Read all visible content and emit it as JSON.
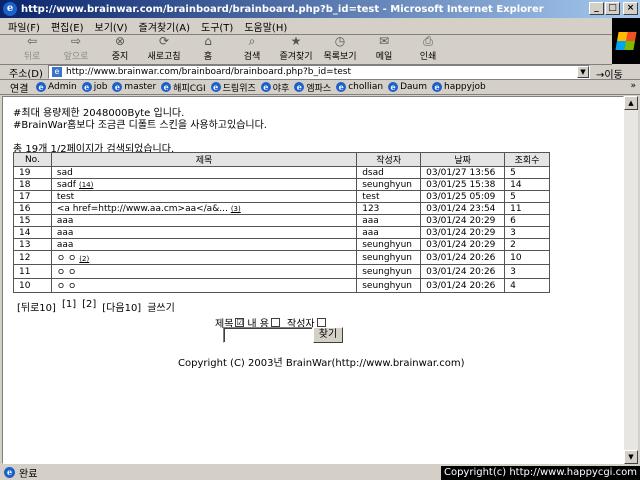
{
  "window": {
    "title": "http://www.brainwar.com/brainboard/brainboard.php?b_id=test - Microsoft Internet Explorer"
  },
  "menu": [
    "파일(F)",
    "편집(E)",
    "보기(V)",
    "즐겨찾기(A)",
    "도구(T)",
    "도움말(H)"
  ],
  "toolbar": [
    {
      "label": "뒤로",
      "icon": "back-arrow-icon",
      "enabled": false
    },
    {
      "label": "앞으로",
      "icon": "forward-arrow-icon",
      "enabled": false
    },
    {
      "label": "중지",
      "icon": "stop-icon",
      "enabled": true
    },
    {
      "label": "새로고침",
      "icon": "refresh-icon",
      "enabled": true
    },
    {
      "label": "홈",
      "icon": "home-icon",
      "enabled": true
    },
    {
      "label": "검색",
      "icon": "search-icon",
      "enabled": true
    },
    {
      "label": "즐겨찾기",
      "icon": "favorites-icon",
      "enabled": true
    },
    {
      "label": "목록보기",
      "icon": "history-icon",
      "enabled": true
    },
    {
      "label": "메일",
      "icon": "mail-icon",
      "enabled": true
    },
    {
      "label": "인쇄",
      "icon": "print-icon",
      "enabled": true
    }
  ],
  "address": {
    "label": "주소(D)",
    "url": "http://www.brainwar.com/brainboard/brainboard.php?b_id=test",
    "go": "이동"
  },
  "links": {
    "label": "연결",
    "items": [
      "Admin",
      "job",
      "master",
      "해피CGI",
      "드림위즈",
      "야후",
      "엠파스",
      "chollian",
      "Daum",
      "happyjob"
    ],
    "more": "»"
  },
  "page": {
    "notice1": "#최대 용량제한 2048000Byte 입니다.",
    "notice2": "#BrainWar홈보다 조금큰 디폴트 스킨을 사용하고있습니다.",
    "count": "총 19개  1/2페이지가 검색되었습니다.",
    "headers": [
      "No.",
      "제목",
      "작성자",
      "날짜",
      "조회수"
    ],
    "rows": [
      {
        "no": "19",
        "title": "sad",
        "comments": "",
        "author": "dsad",
        "date": "03/01/27 13:56",
        "views": "5"
      },
      {
        "no": "18",
        "title": "sadf",
        "comments": "(14)",
        "author": "seunghyun",
        "date": "03/01/25 15:38",
        "views": "14"
      },
      {
        "no": "17",
        "title": "test",
        "comments": "",
        "author": "test",
        "date": "03/01/25 05:09",
        "views": "5"
      },
      {
        "no": "16",
        "title": "<a href=http://www.aa.cm>aa</a&...",
        "comments": "(3)",
        "author": "123",
        "date": "03/01/24 23:54",
        "views": "11"
      },
      {
        "no": "15",
        "title": "aaa",
        "comments": "",
        "author": "aaa",
        "date": "03/01/24 20:29",
        "views": "6"
      },
      {
        "no": "14",
        "title": "aaa",
        "comments": "",
        "author": "aaa",
        "date": "03/01/24 20:29",
        "views": "3"
      },
      {
        "no": "13",
        "title": "aaa",
        "comments": "",
        "author": "seunghyun",
        "date": "03/01/24 20:29",
        "views": "2"
      },
      {
        "no": "12",
        "title": "ㅇ ㅇ",
        "comments": "(2)",
        "author": "seunghyun",
        "date": "03/01/24 20:26",
        "views": "10"
      },
      {
        "no": "11",
        "title": "ㅇ ㅇ",
        "comments": "",
        "author": "seunghyun",
        "date": "03/01/24 20:26",
        "views": "3"
      },
      {
        "no": "10",
        "title": "ㅇ ㅇ",
        "comments": "",
        "author": "seunghyun",
        "date": "03/01/24 20:26",
        "views": "4"
      }
    ],
    "pager": [
      "[뒤로10]",
      "[1]",
      "[2]",
      "[다음10]",
      "글쓰기"
    ],
    "search": {
      "title_label": "제목",
      "title_checked": "☑",
      "content_label": "내   용",
      "author_label": "작성자",
      "button": "찾기"
    },
    "copyright": "Copyright (C) 2003년 BrainWar(http://www.brainwar.com)"
  },
  "status": {
    "text": "완료",
    "overlay": "Copyright(c) http://www.happycgi.com"
  }
}
